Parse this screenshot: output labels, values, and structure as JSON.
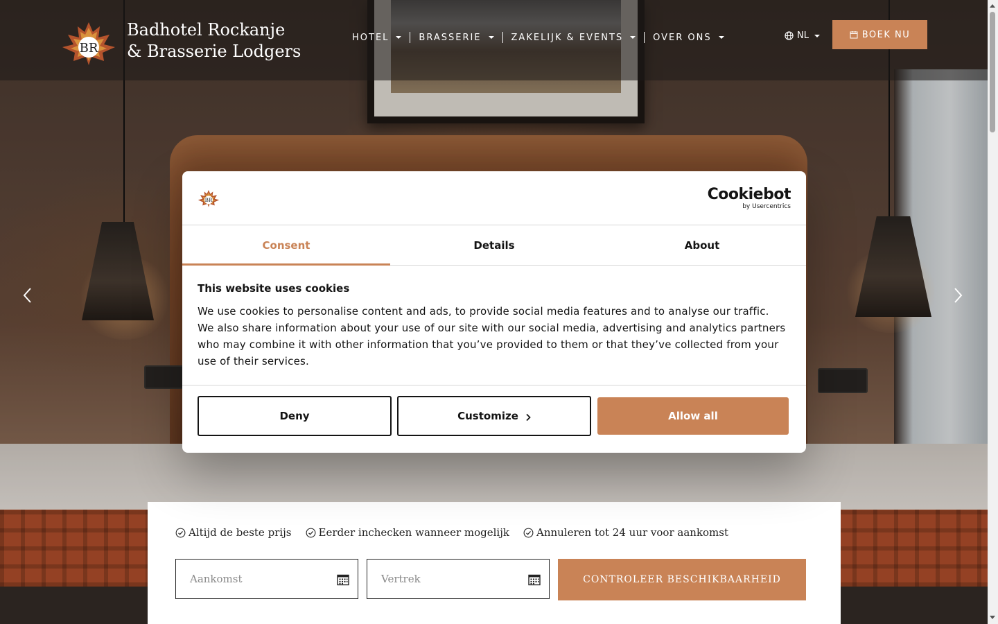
{
  "brand": {
    "line1": "Badhotel Rockanje",
    "line2": "& Brasserie Lodgers"
  },
  "nav": {
    "items": [
      {
        "label": "HOTEL"
      },
      {
        "label": "BRASSERIE"
      },
      {
        "label": "ZAKELIJK & EVENTS"
      },
      {
        "label": "OVER ONS"
      }
    ],
    "language": "NL",
    "book_label": "BOEK NU"
  },
  "cookie_dialog": {
    "provider_name": "Cookiebot",
    "provider_by": "by Usercentrics",
    "tabs": [
      {
        "label": "Consent",
        "active": true
      },
      {
        "label": "Details",
        "active": false
      },
      {
        "label": "About",
        "active": false
      }
    ],
    "title": "This website uses cookies",
    "body": "We use cookies to personalise content and ads, to provide social media features and to analyse our traffic. We also share information about your use of our site with our social media, advertising and analytics partners who may combine it with other information that you’ve provided to them or that they’ve collected from your use of their services.",
    "deny_label": "Deny",
    "customize_label": "Customize",
    "allow_label": "Allow all"
  },
  "booking": {
    "usps": [
      "Altijd de beste prijs",
      "Eerder inchecken wanneer mogelijk",
      "Annuleren tot 24 uur voor aankomst"
    ],
    "arrival_placeholder": "Aankomst",
    "departure_placeholder": "Vertrek",
    "check_label": "CONTROLEER BESCHIKBAARHEID"
  },
  "colors": {
    "accent": "#c98356",
    "text": "#141414"
  },
  "icons": [
    "logo-maple-leaf",
    "globe-icon",
    "calendar-icon",
    "chevron-left-icon",
    "chevron-right-icon",
    "check-circle-icon"
  ]
}
